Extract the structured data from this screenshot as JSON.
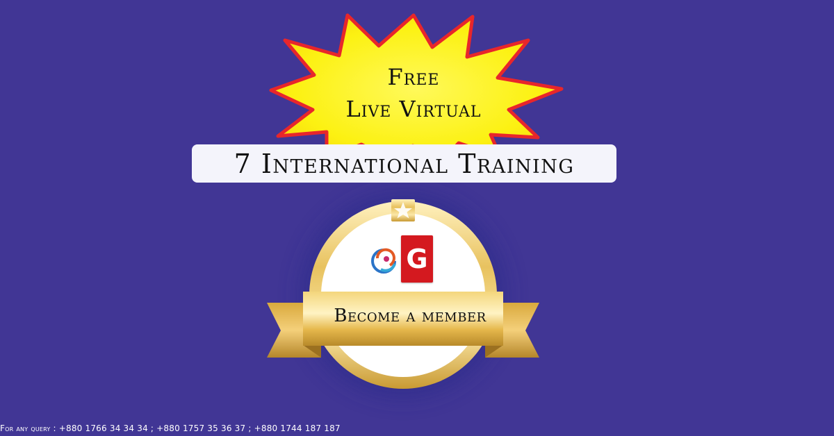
{
  "burst": {
    "line1": "Free",
    "line2": "Live Virtual"
  },
  "title": "7 International Training",
  "badge": {
    "label": "Become a member",
    "logo_letter": "G"
  },
  "footer": "For any query : +880 1766 34 34 34 ; +880 1757 35 36 37 ; +880 1744 187 187",
  "colors": {
    "background": "#413695",
    "burst_fill": "#fcf112",
    "burst_outline": "#e8262b",
    "gold": "#e9c46a",
    "logo_red": "#d4191f"
  }
}
